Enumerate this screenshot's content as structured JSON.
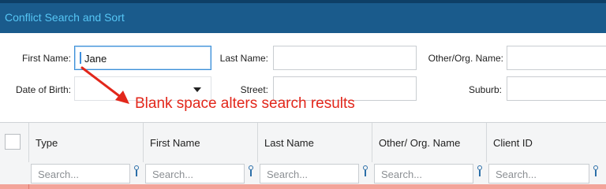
{
  "window": {
    "title": "Conflict Search and Sort"
  },
  "form": {
    "first_name_label": "First Name:",
    "first_name_value": "Jane",
    "last_name_label": "Last Name:",
    "last_name_value": "",
    "other_org_label": "Other/Org. Name:",
    "other_org_value": "",
    "dob_label": "Date of Birth:",
    "dob_value": "",
    "street_label": "Street:",
    "street_value": "",
    "suburb_label": "Suburb:",
    "suburb_value": ""
  },
  "annotation": {
    "text": "Blank space alters search results",
    "color": "#e2271b"
  },
  "grid": {
    "columns": [
      "Type",
      "First Name",
      "Last Name",
      "Other/ Org. Name",
      "Client ID"
    ],
    "search_placeholder": "Search...",
    "selected_row_color": "#f3a49a"
  },
  "icons": {
    "filter": "key-icon",
    "dropdown": "chevron-down-icon"
  }
}
